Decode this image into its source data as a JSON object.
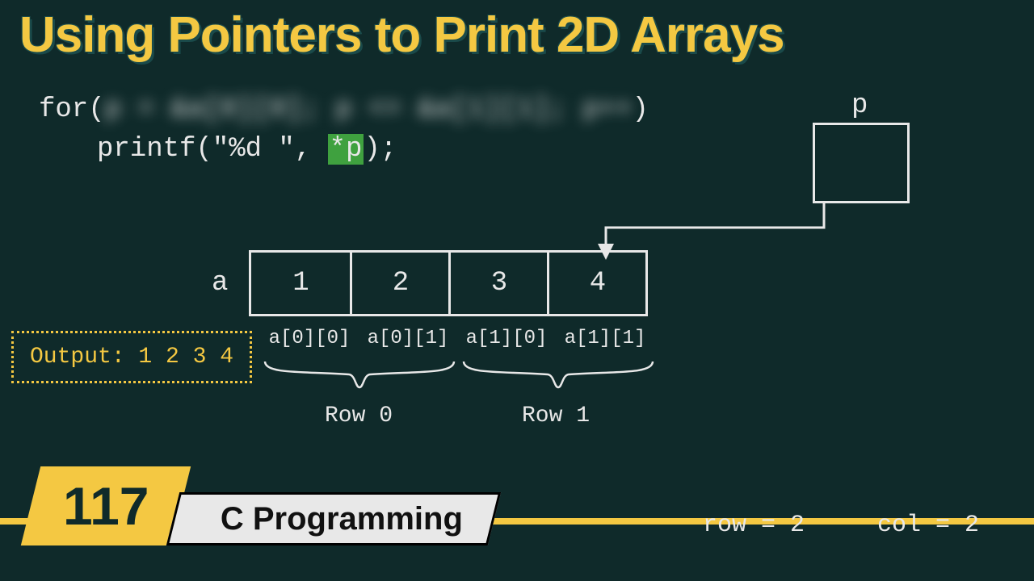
{
  "title": "Using Pointers to Print 2D Arrays",
  "code": {
    "for_keyword": "for(",
    "blurred_cond": "p = &a[0][0]; p <= &a[1][1]; p++",
    "paren_close": ")",
    "printf_prefix": "printf(\"%d \", ",
    "printf_star": "*p",
    "printf_suffix": ");"
  },
  "pointer": {
    "label": "p"
  },
  "array": {
    "name": "a",
    "cells": [
      "1",
      "2",
      "3",
      "4"
    ],
    "indices": [
      "a[0][0]",
      "a[0][1]",
      "a[1][0]",
      "a[1][1]"
    ],
    "rows": [
      "Row 0",
      "Row 1"
    ]
  },
  "output": {
    "label": "Output: 1 2 3 4"
  },
  "footer": {
    "lesson_number": "117",
    "course_title": "C Programming",
    "row_text": "row = 2",
    "col_text": "col = 2"
  }
}
